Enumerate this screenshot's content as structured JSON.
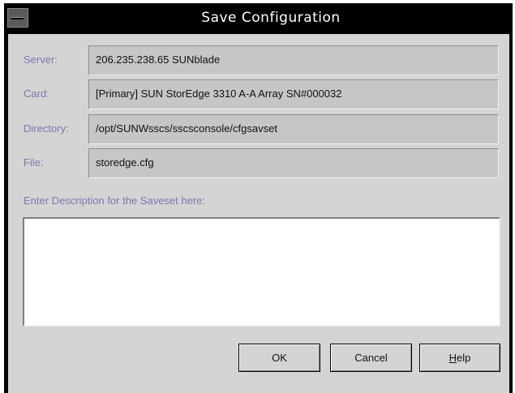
{
  "window": {
    "title": "Save Configuration"
  },
  "form": {
    "server_label": "Server:",
    "server_value": "206.235.238.65 SUNblade",
    "card_label": "Card:",
    "card_value": "[Primary] SUN StorEdge 3310 A-A Array SN#000032",
    "directory_label": "Directory:",
    "directory_value": "/opt/SUNWsscs/sscsconsole/cfgsavset",
    "file_label": "File:",
    "file_value": "storedge.cfg",
    "description_label": "Enter Description for the Saveset here:",
    "description_value": ""
  },
  "buttons": {
    "ok_label": "OK",
    "cancel_label": "Cancel",
    "help_mnemonic": "H",
    "help_rest": "elp"
  },
  "colors": {
    "label": "#7a78b0",
    "titlebar": "#000000",
    "panel": "#d4d4d4",
    "field": "#c6c6c6"
  }
}
